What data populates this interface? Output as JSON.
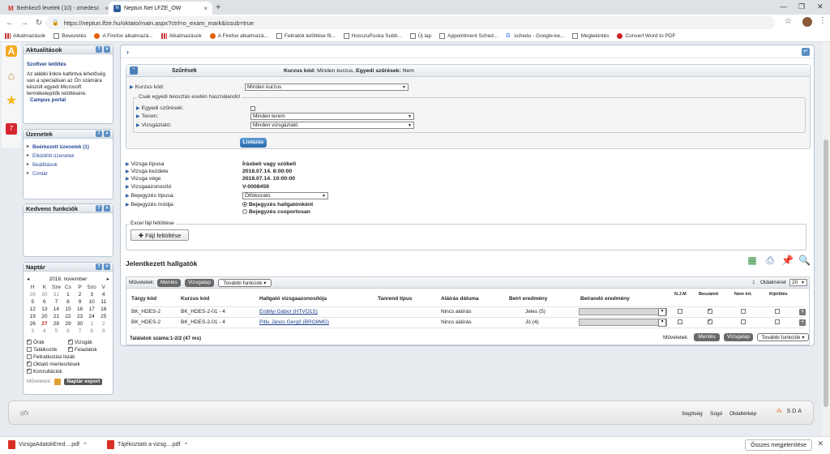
{
  "browser": {
    "tabs": [
      {
        "label": "Beérkező levelek (10) - zmedesc"
      },
      {
        "label": "Neptun.Net LFZE_OW"
      }
    ],
    "url": "https://neptun.lfze.hu/oktato/main.aspx?ctrl=o_exam_mark&issub=true",
    "bookmarks": [
      "Alkalmazások",
      "Bevezetés",
      "A Firefox alkalmazá...",
      "Alkalmazások",
      "A Firefox alkalmazá...",
      "Feliratok letöltése fil...",
      "HosszuPuska Subti...",
      "Új lap",
      "Appointment Sched...",
      "schedu - Google-ke...",
      "Megtekintés",
      "Convert Word to PDF"
    ]
  },
  "sidebar": {
    "aktualitasok": {
      "title": "Aktualitások",
      "heading": "Szoftver letöltés",
      "text": "Az alábbi linkre kattintva lehetőség van a specialisan az Ön számára készült egyedi Microsoft termékelepítők letöltésére.",
      "link": "Campus portál"
    },
    "uzenetek": {
      "title": "Üzenetek",
      "items": [
        "Beérkezett üzenetek (1)",
        "Elküldött üzenetek",
        "Beállítások",
        "Címtár"
      ]
    },
    "kedvenc": {
      "title": "Kedvenc funkciók"
    },
    "naptar": {
      "title": "Naptár",
      "month": "2018. november",
      "prev": "◂",
      "next": "▸",
      "weekdays": [
        "H",
        "K",
        "Sze",
        "Cs",
        "P",
        "Szo",
        "V"
      ],
      "weeks": [
        [
          "29",
          "30",
          "31",
          "1",
          "2",
          "3",
          "4"
        ],
        [
          "5",
          "6",
          "7",
          "8",
          "9",
          "10",
          "11"
        ],
        [
          "12",
          "13",
          "14",
          "15",
          "16",
          "17",
          "18"
        ],
        [
          "19",
          "20",
          "21",
          "22",
          "23",
          "24",
          "25"
        ],
        [
          "26",
          "27",
          "28",
          "29",
          "30",
          "1",
          "2"
        ],
        [
          "3",
          "4",
          "5",
          "6",
          "7",
          "8",
          "9"
        ]
      ],
      "filters": [
        {
          "label": "Órák",
          "checked": true
        },
        {
          "label": "Vizsgák",
          "checked": true
        },
        {
          "label": "Találkozók",
          "checked": false
        },
        {
          "label": "Feladatok",
          "checked": true
        },
        {
          "label": "Feliratkozási listák",
          "checked": false
        },
        {
          "label": "Oktató mentesítések",
          "checked": true
        },
        {
          "label": "Konzultációk",
          "checked": true
        }
      ],
      "actions_label": "Műveletek:",
      "export_button": "Naptár export"
    }
  },
  "filter": {
    "title": "Szűrések",
    "summary_label1": "Kurzus kód:",
    "summary_value1": "Minden kurzus,",
    "summary_label2": "Egyedi szűrések:",
    "summary_value2": "Nem",
    "kurzus_label": "Kurzus kód:",
    "kurzus_value": "Minden kurzus",
    "group_legend": "Csak egyedi beosztás esetén használandó!",
    "egyedi_label": "Egyedi szűrések:",
    "terem_label": "Terem:",
    "terem_value": "Minden terem",
    "vizsgaztato_label": "Vizsgáztató:",
    "vizsgaztato_value": "Minden vizsgáztató",
    "list_button": "Listázás"
  },
  "exam_info": [
    {
      "label": "Vizsga típusa",
      "value": "Írásbeli vagy szóbeli"
    },
    {
      "label": "Vizsga kezdete",
      "value": "2018.07.14. 8:00:00"
    },
    {
      "label": "Vizsga vége",
      "value": "2018.07.14. 10:00:00"
    },
    {
      "label": "Vizsgaazonosító",
      "value": "V-0008459"
    }
  ],
  "bejegyzes": {
    "type_label": "Bejegyzés típusa:",
    "type_value": "Ötfokozatú",
    "mode_label": "Bejegyzés módja:",
    "mode_option1": "Bejegyzés hallgatónként",
    "mode_option2": "Bejegyzés csoportosan"
  },
  "excel": {
    "legend": "Excel fájl feltöltése",
    "button": "Fájl feltöltése"
  },
  "students": {
    "title": "Jelentkezett hallgatók",
    "toolbar": {
      "label": "Műveletek:",
      "save": "Mentés",
      "exam_base": "Vizsgalap",
      "more": "További funkciók",
      "page_num": "1",
      "page_size_label": "Oldalméret",
      "page_size": "20"
    },
    "columns": [
      "Tárgy kód",
      "Kurzus kód",
      "Hallgató vizsgaazonosítója",
      "Tanrend típus",
      "Aláírás dátuma",
      "Beírt eredmény",
      "Beírandó eredmény",
      "N.J.M",
      "Beszámít",
      "Nem ért.",
      "Kijelölés"
    ],
    "rows": [
      {
        "targy": "BK_HDES-2",
        "kurzus": "BK_HDES-2-01 - 4",
        "hallgato": "Erdélyi Gábor (HTVO1S)",
        "tanrend": "",
        "alairas": "Nincs aláírás",
        "eredmeny": "Jeles (5)",
        "njm": false,
        "beszamit": true,
        "nemert": false,
        "kijeloles": false
      },
      {
        "targy": "BK_HDES-2",
        "kurzus": "BK_HDES-2-01 - 4",
        "hallgato": "Pitlu János Gergő (BRO8MG)",
        "tanrend": "",
        "alairas": "Nincs aláírás",
        "eredmeny": "Jó (4)",
        "njm": false,
        "beszamit": true,
        "nemert": false,
        "kijeloles": false
      }
    ],
    "count_text": "Találatok száma:1-2/2 (47 ms)"
  },
  "footer": {
    "logo": "qfx",
    "links": [
      "Segítség",
      "Súgó",
      "Oldaltérkép"
    ],
    "brand": "SDA"
  },
  "downloads": {
    "items": [
      "VizsgaAdatokEred....pdf",
      "Tájékoztató a vizsg....pdf"
    ],
    "show_all": "Összes megjelenítése"
  }
}
